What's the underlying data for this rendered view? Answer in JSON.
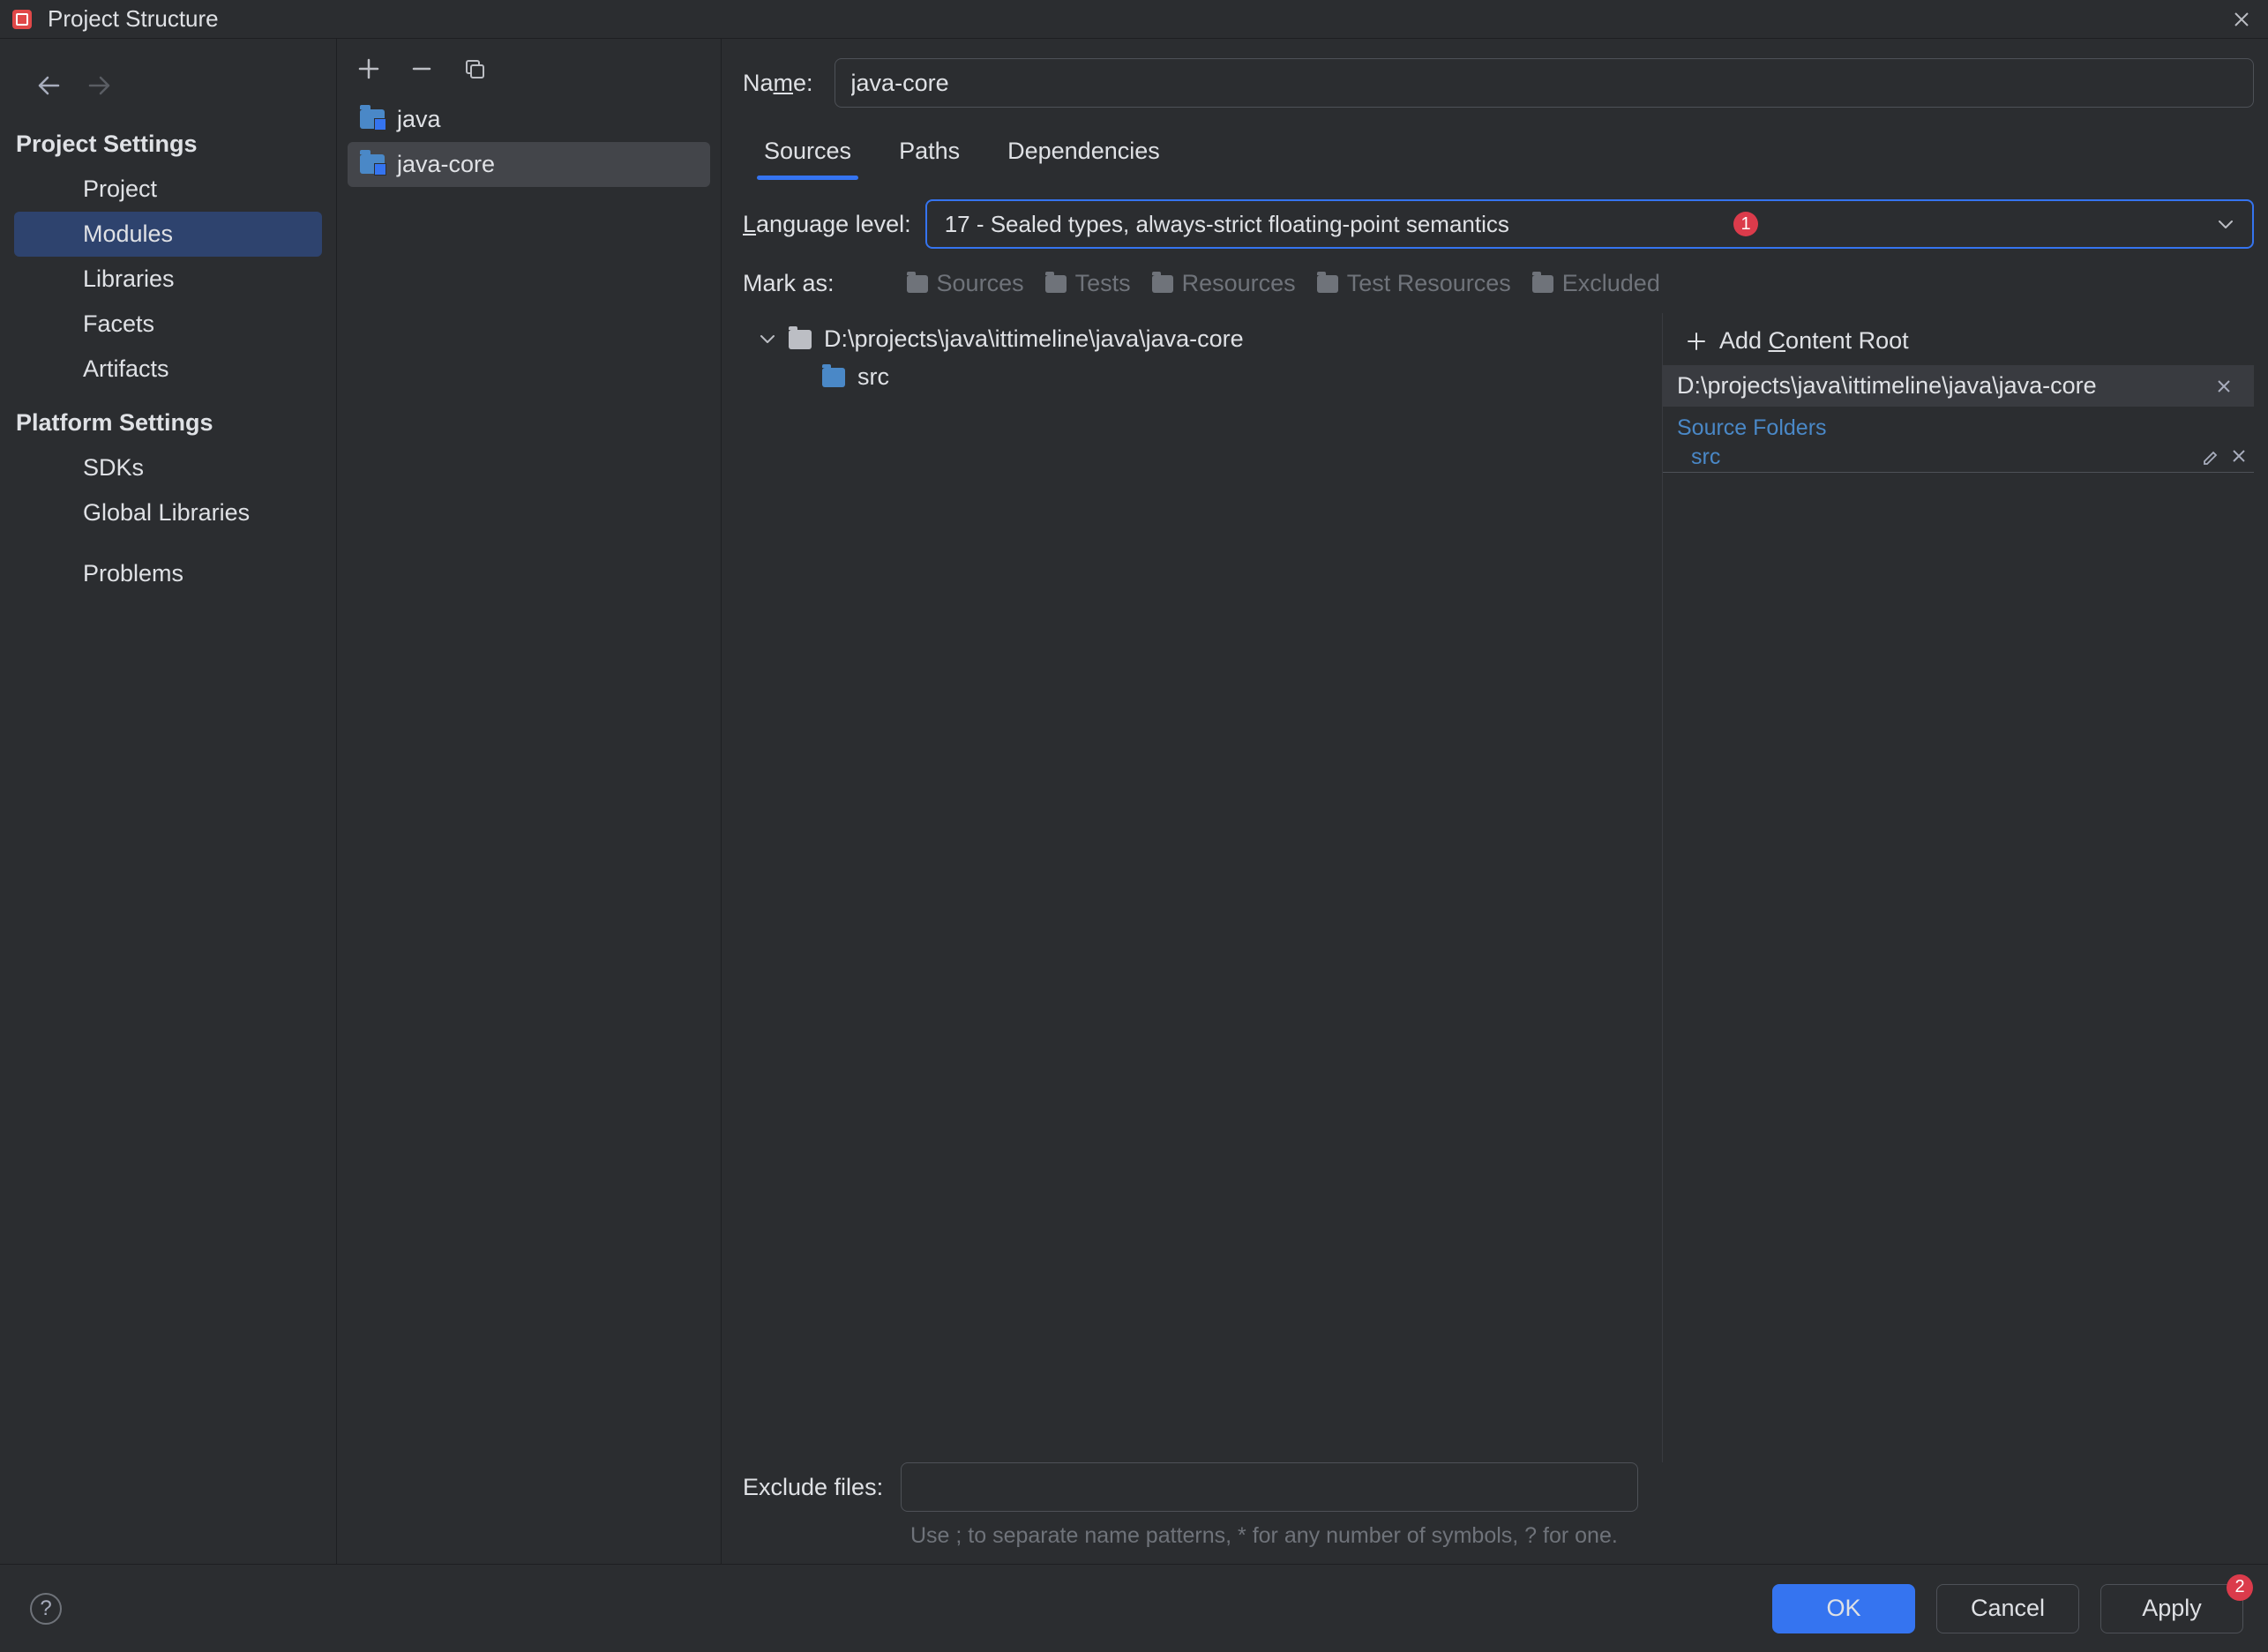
{
  "window": {
    "title": "Project Structure"
  },
  "left_nav": {
    "sections": [
      {
        "title": "Project Settings",
        "items": [
          "Project",
          "Modules",
          "Libraries",
          "Facets",
          "Artifacts"
        ],
        "selected_index": 1
      },
      {
        "title": "Platform Settings",
        "items": [
          "SDKs",
          "Global Libraries"
        ]
      },
      {
        "title": "",
        "items": [
          "Problems"
        ]
      }
    ]
  },
  "modules": {
    "items": [
      {
        "name": "java"
      },
      {
        "name": "java-core"
      }
    ],
    "selected_index": 1
  },
  "detail": {
    "name_label": "Name:",
    "name_value": "java-core",
    "tabs": [
      "Sources",
      "Paths",
      "Dependencies"
    ],
    "active_tab": 0,
    "language_level_label": "Language level:",
    "language_level_value": "17 - Sealed types, always-strict floating-point semantics",
    "mark_as_label": "Mark as:",
    "mark_as_options": [
      "Sources",
      "Tests",
      "Resources",
      "Test Resources",
      "Excluded"
    ],
    "tree": {
      "root": "D:\\projects\\java\\ittimeline\\java\\java-core",
      "children": [
        "src"
      ]
    },
    "content_root": {
      "add_label": "Add Content Root",
      "path": "D:\\projects\\java\\ittimeline\\java\\java-core",
      "source_folders_label": "Source Folders",
      "source_entries": [
        "src"
      ]
    },
    "exclude": {
      "label": "Exclude files:",
      "hint": "Use ; to separate name patterns, * for any number of symbols, ? for one."
    }
  },
  "badges": {
    "lang_level": "1",
    "apply": "2"
  },
  "bottom": {
    "ok": "OK",
    "cancel": "Cancel",
    "apply": "Apply"
  }
}
